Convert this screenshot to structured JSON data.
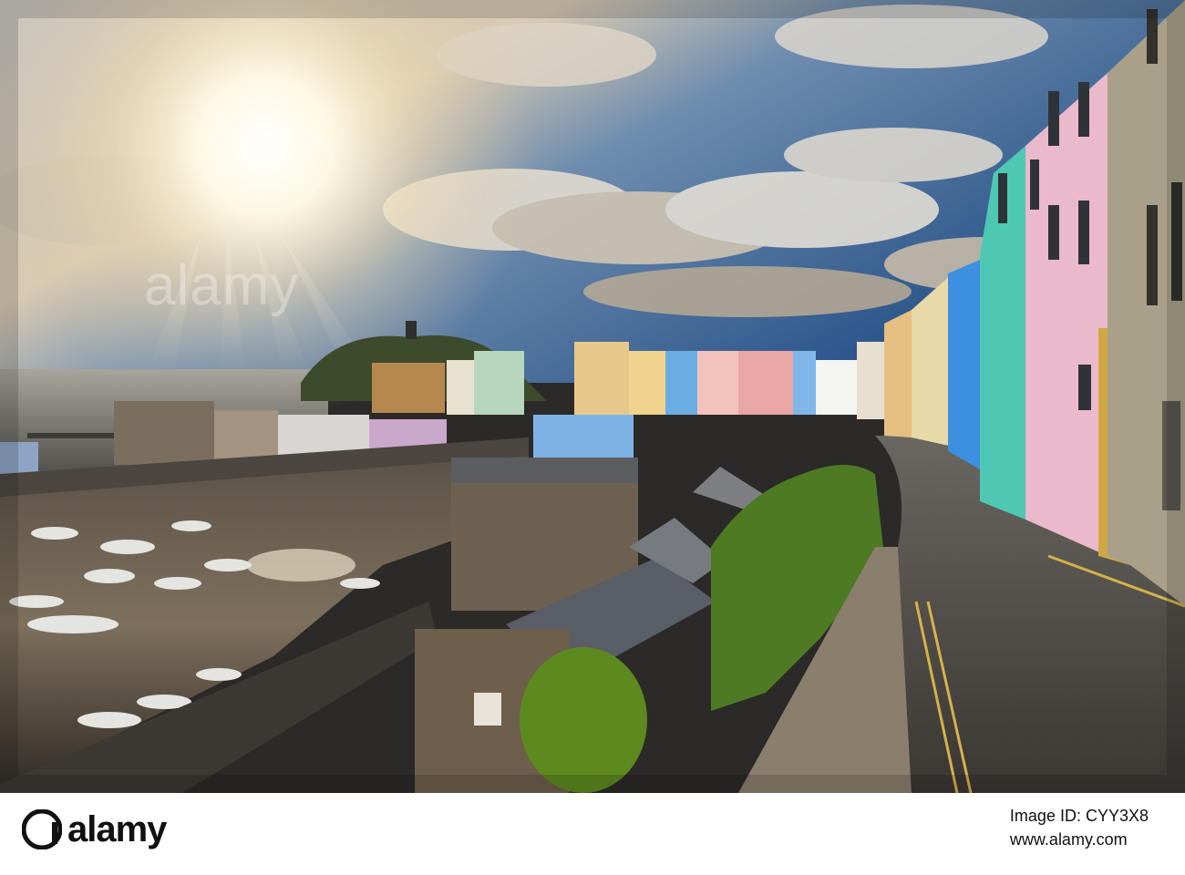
{
  "photo": {
    "subject_icon": "harbour-photo",
    "watermark_text": "alamy",
    "colors": {
      "sky_top": "#2e5f93",
      "sun": "#fffbe8",
      "sea": "#7c7a72",
      "pink_house": "#e9b9c6",
      "teal_house": "#4ec7b3",
      "blue_house": "#2f7fd0"
    }
  },
  "footer": {
    "brand": "alamy",
    "image_id_line": "Image ID: CYY3X8",
    "site_line": "www.alamy.com"
  }
}
